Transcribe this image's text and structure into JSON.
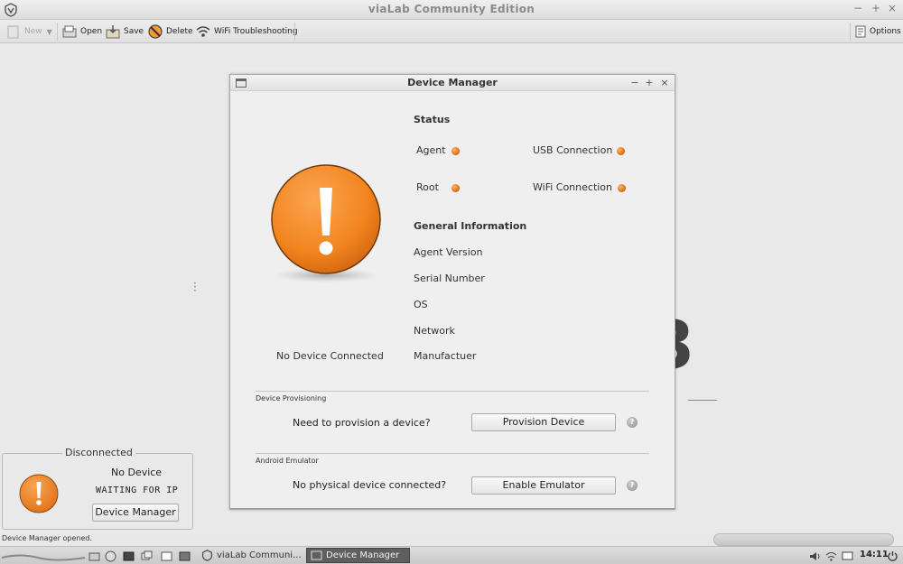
{
  "window": {
    "title": "viaLab Community Edition"
  },
  "toolbar": {
    "new_label": "New",
    "open_label": "Open",
    "save_label": "Save",
    "delete_label": "Delete",
    "wifi_label": "WiFi Troubleshooting",
    "options_label": "Options"
  },
  "dialog": {
    "title": "Device Manager",
    "no_device_label": "No Device Connected",
    "status": {
      "heading": "Status",
      "agent": "Agent",
      "root": "Root",
      "usb": "USB Connection",
      "wifi": "WiFi Connection",
      "indicator_color": "#f0821e"
    },
    "general": {
      "heading": "General Information",
      "agent_version": "Agent Version",
      "serial_number": "Serial Number",
      "os": "OS",
      "network": "Network",
      "manufacturer": "Manufactuer"
    },
    "provisioning": {
      "group_label": "Device Provisioning",
      "prompt": "Need to provision a device?",
      "button": "Provision Device"
    },
    "emulator": {
      "group_label": "Android Emulator",
      "prompt": "No physical device connected?",
      "button": "Enable Emulator"
    }
  },
  "background": {
    "digit": "3"
  },
  "device_panel": {
    "title": "Disconnected",
    "device_label": "No Device",
    "waiting_label": "WAITING FOR IP",
    "button": "Device Manager",
    "warning_color": "#f0821e"
  },
  "status_bar": {
    "message": "Device Manager opened."
  },
  "taskbar": {
    "task1": "viaLab Communi...",
    "task2": "Device Manager",
    "clock": "14:11"
  }
}
